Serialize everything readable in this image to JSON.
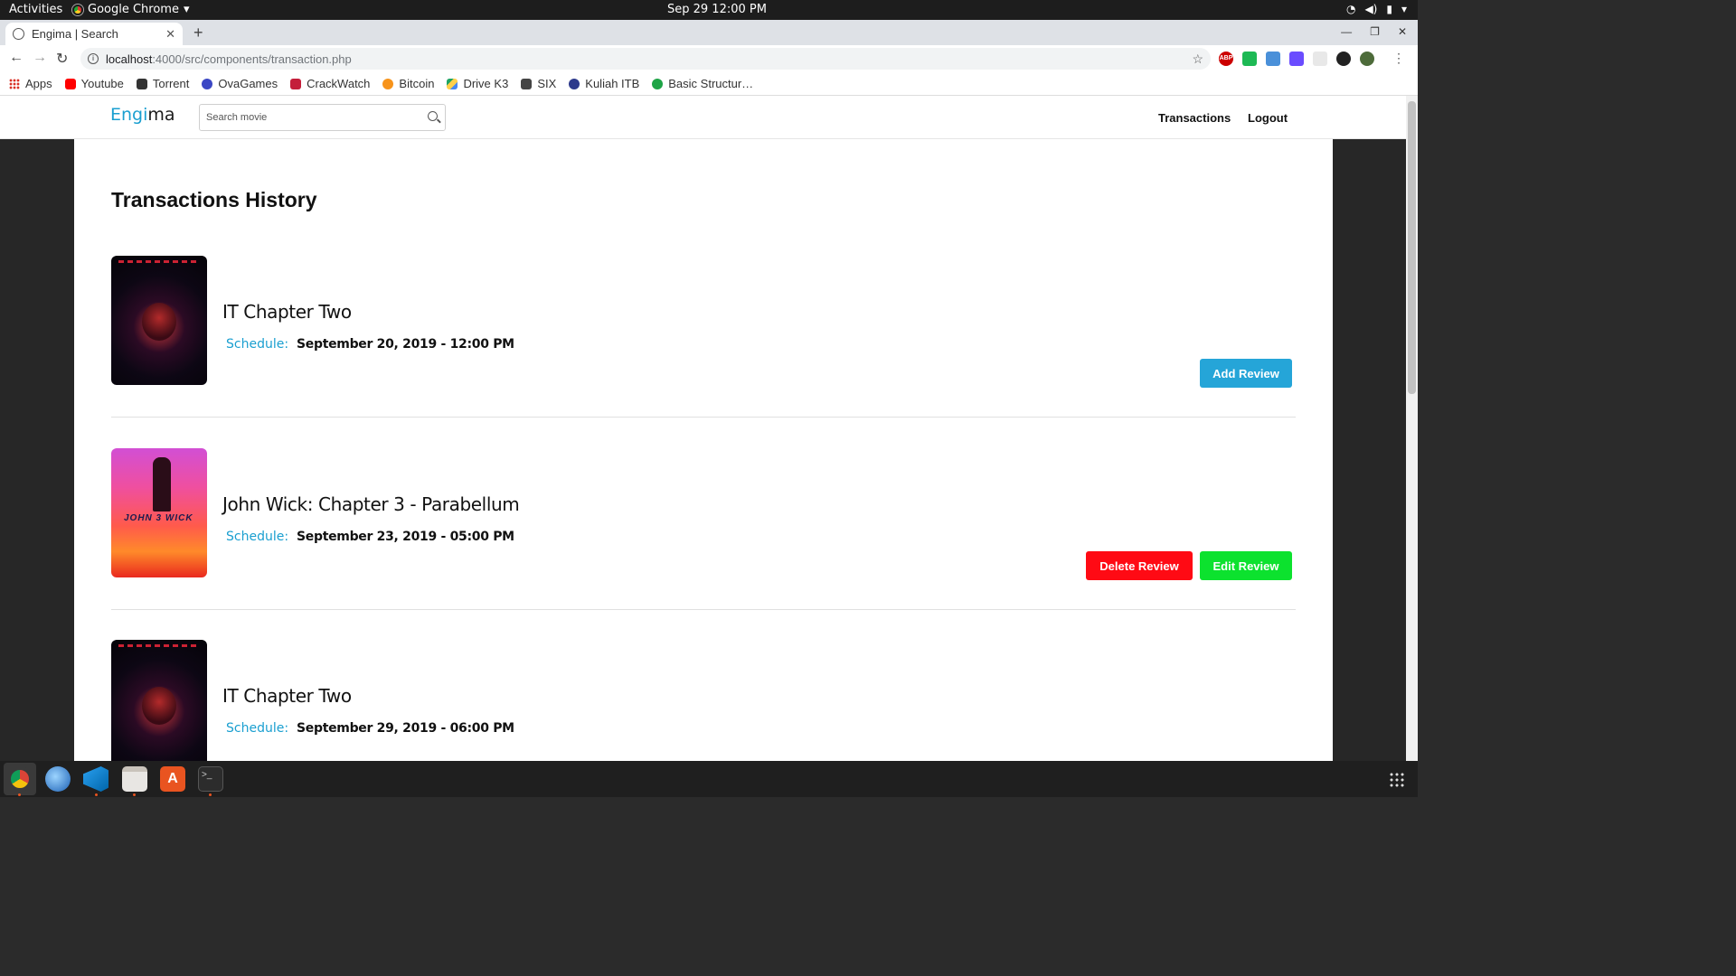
{
  "topbar": {
    "activities": "Activities",
    "app_name": "Google Chrome",
    "clock": "Sep 29  12:00 PM"
  },
  "browser": {
    "tab_title": "Engima | Search",
    "url_host": "localhost",
    "url_path": ":4000/src/components/transaction.php",
    "bookmarks": [
      "Apps",
      "Youtube",
      "Torrent",
      "OvaGames",
      "CrackWatch",
      "Bitcoin",
      "Drive K3",
      "SIX",
      "Kuliah ITB",
      "Basic Structur…"
    ],
    "bookmark_colors": [
      "#d93025",
      "#ff0000",
      "#333333",
      "#3b47c4",
      "#c41e3a",
      "#f7931a",
      "#1fa463",
      "#444444",
      "#2d3a8c",
      "#1ea446"
    ]
  },
  "site": {
    "brand_part1": "Engi",
    "brand_part2": "ma",
    "brand_color": "#1a9fd0",
    "search_placeholder": "Search movie",
    "nav": {
      "transactions": "Transactions",
      "logout": "Logout"
    }
  },
  "page": {
    "title": "Transactions History",
    "schedule_label": "Schedule:",
    "transactions": [
      {
        "title": "IT Chapter Two",
        "schedule": "September 20, 2019 - 12:00 PM",
        "poster": "it-chapter-two-poster",
        "actions": [
          "Add Review"
        ]
      },
      {
        "title": "John Wick: Chapter 3 - Parabellum",
        "schedule": "September 23, 2019 - 05:00 PM",
        "poster": "john-wick-poster",
        "actions": [
          "Delete Review",
          "Edit Review"
        ]
      },
      {
        "title": "IT Chapter Two",
        "schedule": "September 29, 2019 - 06:00 PM",
        "poster": "it-chapter-two-poster",
        "actions": []
      }
    ],
    "button_colors": {
      "add": "#25a5d8",
      "edit": "#0ce22e",
      "delete": "#ff0a14"
    }
  },
  "dock": {
    "apps": [
      "chrome-icon",
      "thunderbird-icon",
      "vscode-icon",
      "files-icon",
      "software-center-icon",
      "terminal-icon"
    ]
  }
}
